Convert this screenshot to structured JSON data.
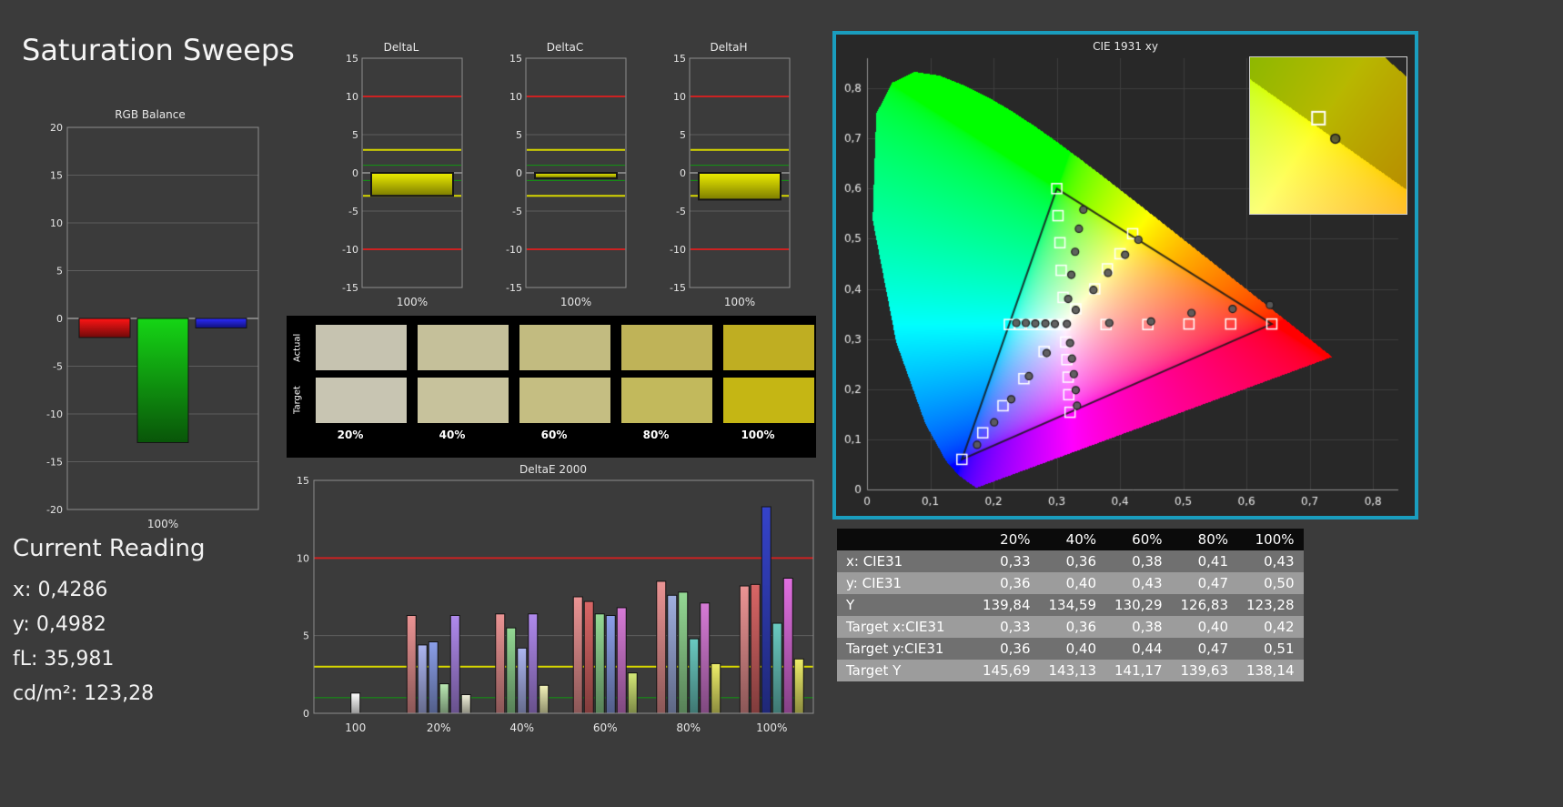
{
  "page_title": "Saturation Sweeps",
  "current_reading": {
    "title": "Current Reading",
    "lines": [
      {
        "label": "x:",
        "value": "0,4286"
      },
      {
        "label": "y:",
        "value": "0,4982"
      },
      {
        "label": "fL:",
        "value": "35,981"
      },
      {
        "label": "cd/m²:",
        "value": "123,28"
      }
    ]
  },
  "swatch_panel": {
    "row_labels": [
      "Actual",
      "Target"
    ],
    "column_labels": [
      "20%",
      "40%",
      "60%",
      "80%",
      "100%"
    ],
    "actual_colors": [
      "#c6c3b0",
      "#c5c09a",
      "#c2bb80",
      "#bfb358",
      "#bfae22"
    ],
    "target_colors": [
      "#c8c5b2",
      "#c7c29c",
      "#c5be82",
      "#c2b95c",
      "#c5b614"
    ]
  },
  "chart_data": [
    {
      "id": "rgb_balance",
      "type": "bar",
      "title": "RGB Balance",
      "categories": [
        "100%"
      ],
      "series": [
        {
          "name": "Red",
          "color": "#dd1111",
          "values": [
            -2
          ]
        },
        {
          "name": "Green",
          "color": "#11aa11",
          "values": [
            -13
          ]
        },
        {
          "name": "Blue",
          "color": "#2222ee",
          "values": [
            -1
          ]
        }
      ],
      "ylim": [
        -20,
        20
      ],
      "ytick_step": 5,
      "xlabel": "100%"
    },
    {
      "id": "deltaL",
      "type": "bar",
      "title": "DeltaL",
      "categories": [
        "100%"
      ],
      "values": [
        -3
      ],
      "ylim": [
        -15,
        15
      ],
      "ytick_step": 5,
      "xlabel": "100%",
      "bar_color": "#cfcf00",
      "ref_lines": [
        {
          "y": 10,
          "color": "#cc2222"
        },
        {
          "y": -10,
          "color": "#cc2222"
        },
        {
          "y": 3,
          "color": "#d6d600"
        },
        {
          "y": -3,
          "color": "#d6d600"
        },
        {
          "y": 1,
          "color": "#119911"
        },
        {
          "y": -1,
          "color": "#119911"
        }
      ]
    },
    {
      "id": "deltaC",
      "type": "bar",
      "title": "DeltaC",
      "categories": [
        "100%"
      ],
      "values": [
        -0.7
      ],
      "ylim": [
        -15,
        15
      ],
      "ytick_step": 5,
      "xlabel": "100%",
      "bar_color": "#cfcf00",
      "ref_lines": [
        {
          "y": 10,
          "color": "#cc2222"
        },
        {
          "y": -10,
          "color": "#cc2222"
        },
        {
          "y": 3,
          "color": "#d6d600"
        },
        {
          "y": -3,
          "color": "#d6d600"
        },
        {
          "y": 1,
          "color": "#119911"
        },
        {
          "y": -1,
          "color": "#119911"
        }
      ]
    },
    {
      "id": "deltaH",
      "type": "bar",
      "title": "DeltaH",
      "categories": [
        "100%"
      ],
      "values": [
        -3.5
      ],
      "ylim": [
        -15,
        15
      ],
      "ytick_step": 5,
      "xlabel": "100%",
      "bar_color": "#cfcf00",
      "ref_lines": [
        {
          "y": 10,
          "color": "#cc2222"
        },
        {
          "y": -10,
          "color": "#cc2222"
        },
        {
          "y": 3,
          "color": "#d6d600"
        },
        {
          "y": -3,
          "color": "#d6d600"
        },
        {
          "y": 1,
          "color": "#119911"
        },
        {
          "y": -1,
          "color": "#119911"
        }
      ]
    },
    {
      "id": "deltae2000",
      "type": "bar",
      "title": "DeltaE 2000",
      "ylim": [
        0,
        15
      ],
      "ytick_step": 5,
      "ref_lines": [
        {
          "y": 10,
          "color": "#cc2222"
        },
        {
          "y": 3,
          "color": "#d6d600"
        },
        {
          "y": 1,
          "color": "#119911"
        }
      ],
      "groups": [
        {
          "label": "100",
          "bars": [
            {
              "color": "#e8e8e8",
              "value": 1.3
            }
          ]
        },
        {
          "label": "20%",
          "bars": [
            {
              "color": "#d28484",
              "value": 6.3
            },
            {
              "color": "#9aa2d6",
              "value": 4.4
            },
            {
              "color": "#7c8ed0",
              "value": 4.6
            },
            {
              "color": "#a6cfa0",
              "value": 1.9
            },
            {
              "color": "#9d7bd4",
              "value": 6.3
            },
            {
              "color": "#d8d8c4",
              "value": 1.2
            }
          ]
        },
        {
          "label": "40%",
          "bars": [
            {
              "color": "#d28484",
              "value": 6.4
            },
            {
              "color": "#84c284",
              "value": 5.5
            },
            {
              "color": "#9aa2d6",
              "value": 4.2
            },
            {
              "color": "#9d7bd4",
              "value": 6.4
            },
            {
              "color": "#d8d8a4",
              "value": 1.8
            }
          ]
        },
        {
          "label": "60%",
          "bars": [
            {
              "color": "#d28484",
              "value": 7.5
            },
            {
              "color": "#c25b5b",
              "value": 7.2
            },
            {
              "color": "#84c284",
              "value": 6.4
            },
            {
              "color": "#7c8ed0",
              "value": 6.3
            },
            {
              "color": "#c06ec0",
              "value": 6.8
            },
            {
              "color": "#bccf6a",
              "value": 2.6
            }
          ]
        },
        {
          "label": "80%",
          "bars": [
            {
              "color": "#d28484",
              "value": 8.5
            },
            {
              "color": "#8f9cc8",
              "value": 7.6
            },
            {
              "color": "#84c284",
              "value": 7.8
            },
            {
              "color": "#5fb4ac",
              "value": 4.8
            },
            {
              "color": "#c06ec0",
              "value": 7.1
            },
            {
              "color": "#d4d45e",
              "value": 3.2
            }
          ]
        },
        {
          "label": "100%",
          "bars": [
            {
              "color": "#d28484",
              "value": 8.2
            },
            {
              "color": "#c25b5b",
              "value": 8.3
            },
            {
              "color": "#2f3cb4",
              "value": 13.3
            },
            {
              "color": "#5fb4ac",
              "value": 5.8
            },
            {
              "color": "#c963c9",
              "value": 8.7
            },
            {
              "color": "#d4d45e",
              "value": 3.5
            }
          ]
        }
      ]
    },
    {
      "id": "cie1931",
      "type": "scatter",
      "title": "CIE 1931 xy",
      "xlim": [
        0,
        0.84
      ],
      "ylim": [
        0,
        0.86
      ],
      "xticks": [
        "0",
        "0,1",
        "0,2",
        "0,3",
        "0,4",
        "0,5",
        "0,6",
        "0,7",
        "0,8"
      ],
      "yticks": [
        "0",
        "0,1",
        "0,2",
        "0,3",
        "0,4",
        "0,5",
        "0,6",
        "0,7",
        "0,8"
      ],
      "border_color": "#1a9dbe",
      "gamut_triangle": {
        "red": [
          0.64,
          0.33
        ],
        "green": [
          0.3,
          0.6
        ],
        "blue": [
          0.15,
          0.06
        ]
      },
      "white_point": [
        0.3127,
        0.329
      ],
      "targets": [
        [
          0.378,
          0.329
        ],
        [
          0.444,
          0.329
        ],
        [
          0.509,
          0.33
        ],
        [
          0.575,
          0.33
        ],
        [
          0.64,
          0.33
        ],
        [
          0.31,
          0.383
        ],
        [
          0.307,
          0.437
        ],
        [
          0.305,
          0.492
        ],
        [
          0.302,
          0.546
        ],
        [
          0.3,
          0.6
        ],
        [
          0.28,
          0.275
        ],
        [
          0.248,
          0.221
        ],
        [
          0.215,
          0.167
        ],
        [
          0.183,
          0.113
        ],
        [
          0.15,
          0.06
        ],
        [
          0.33,
          0.36
        ],
        [
          0.36,
          0.4
        ],
        [
          0.38,
          0.44
        ],
        [
          0.4,
          0.47
        ],
        [
          0.42,
          0.51
        ],
        [
          0.295,
          0.329
        ],
        [
          0.277,
          0.329
        ],
        [
          0.26,
          0.329
        ],
        [
          0.242,
          0.329
        ],
        [
          0.225,
          0.329
        ],
        [
          0.314,
          0.294
        ],
        [
          0.316,
          0.259
        ],
        [
          0.318,
          0.224
        ],
        [
          0.319,
          0.189
        ],
        [
          0.321,
          0.154
        ],
        [
          0.3127,
          0.329
        ]
      ],
      "measurements": [
        [
          0.383,
          0.332
        ],
        [
          0.449,
          0.335
        ],
        [
          0.513,
          0.352
        ],
        [
          0.578,
          0.36
        ],
        [
          0.637,
          0.368
        ],
        [
          0.318,
          0.38
        ],
        [
          0.323,
          0.428
        ],
        [
          0.329,
          0.474
        ],
        [
          0.335,
          0.52
        ],
        [
          0.342,
          0.558
        ],
        [
          0.284,
          0.272
        ],
        [
          0.256,
          0.226
        ],
        [
          0.228,
          0.18
        ],
        [
          0.201,
          0.134
        ],
        [
          0.174,
          0.089
        ],
        [
          0.33,
          0.358
        ],
        [
          0.358,
          0.398
        ],
        [
          0.381,
          0.432
        ],
        [
          0.408,
          0.468
        ],
        [
          0.429,
          0.498
        ],
        [
          0.297,
          0.33
        ],
        [
          0.282,
          0.331
        ],
        [
          0.266,
          0.331
        ],
        [
          0.251,
          0.332
        ],
        [
          0.236,
          0.332
        ],
        [
          0.321,
          0.292
        ],
        [
          0.324,
          0.261
        ],
        [
          0.327,
          0.23
        ],
        [
          0.33,
          0.198
        ],
        [
          0.332,
          0.167
        ],
        [
          0.316,
          0.33
        ]
      ],
      "inset": {
        "x_range": [
          0.385,
          0.465
        ],
        "y_range": [
          0.455,
          0.545
        ],
        "target": [
          0.42,
          0.51
        ],
        "measurement": [
          0.4286,
          0.4982
        ]
      }
    },
    {
      "id": "measurement_table",
      "type": "table",
      "columns": [
        "20%",
        "40%",
        "60%",
        "80%",
        "100%"
      ],
      "rows": [
        {
          "label": "x: CIE31",
          "values": [
            "0,33",
            "0,36",
            "0,38",
            "0,41",
            "0,43"
          ]
        },
        {
          "label": "y: CIE31",
          "values": [
            "0,36",
            "0,40",
            "0,43",
            "0,47",
            "0,50"
          ]
        },
        {
          "label": "Y",
          "values": [
            "139,84",
            "134,59",
            "130,29",
            "126,83",
            "123,28"
          ]
        },
        {
          "label": "Target x:CIE31",
          "values": [
            "0,33",
            "0,36",
            "0,38",
            "0,40",
            "0,42"
          ]
        },
        {
          "label": "Target y:CIE31",
          "values": [
            "0,36",
            "0,40",
            "0,44",
            "0,47",
            "0,51"
          ]
        },
        {
          "label": "Target Y",
          "values": [
            "145,69",
            "143,13",
            "141,17",
            "139,63",
            "138,14"
          ]
        }
      ]
    }
  ]
}
